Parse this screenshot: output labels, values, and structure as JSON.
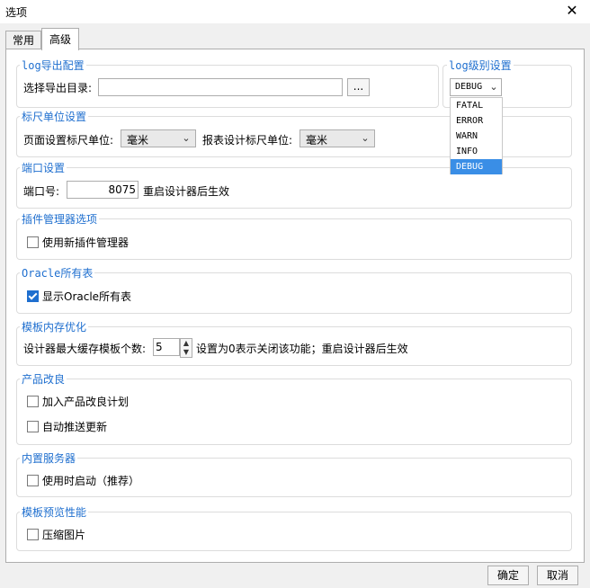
{
  "window": {
    "title": "选项",
    "close": "✕"
  },
  "tabs": [
    {
      "label": "常用"
    },
    {
      "label": "高级"
    }
  ],
  "log_export": {
    "title": "log导出配置",
    "label": "选择导出目录:",
    "path": "",
    "browse": "..."
  },
  "log_level": {
    "title": "log级别设置",
    "selected": "DEBUG",
    "options": [
      "FATAL",
      "ERROR",
      "WARN",
      "INFO",
      "DEBUG"
    ]
  },
  "ruler": {
    "title": "标尺单位设置",
    "page_label": "页面设置标尺单位:",
    "page_value": "毫米",
    "report_label": "报表设计标尺单位:",
    "report_value": "毫米"
  },
  "port": {
    "title": "端口设置",
    "label": "端口号:",
    "value": "8075",
    "note": "重启设计器后生效"
  },
  "plugin": {
    "title": "插件管理器选项",
    "option": "使用新插件管理器",
    "checked": false
  },
  "oracle": {
    "title": "Oracle所有表",
    "option": "显示Oracle所有表",
    "checked": true
  },
  "template_memory": {
    "title": "模板内存优化",
    "label": "设计器最大缓存模板个数:",
    "value": "5",
    "note": "设置为0表示关闭该功能；重启设计器后生效"
  },
  "product": {
    "title": "产品改良",
    "option1": "加入产品改良计划",
    "option2": "自动推送更新"
  },
  "server": {
    "title": "内置服务器",
    "option": "使用时启动（推荐）"
  },
  "preview": {
    "title": "模板预览性能",
    "option": "压缩图片"
  },
  "footer": {
    "ok": "确定",
    "cancel": "取消"
  },
  "colors": {
    "accent": "#1f6fcf",
    "selection": "#3a8ee6"
  }
}
